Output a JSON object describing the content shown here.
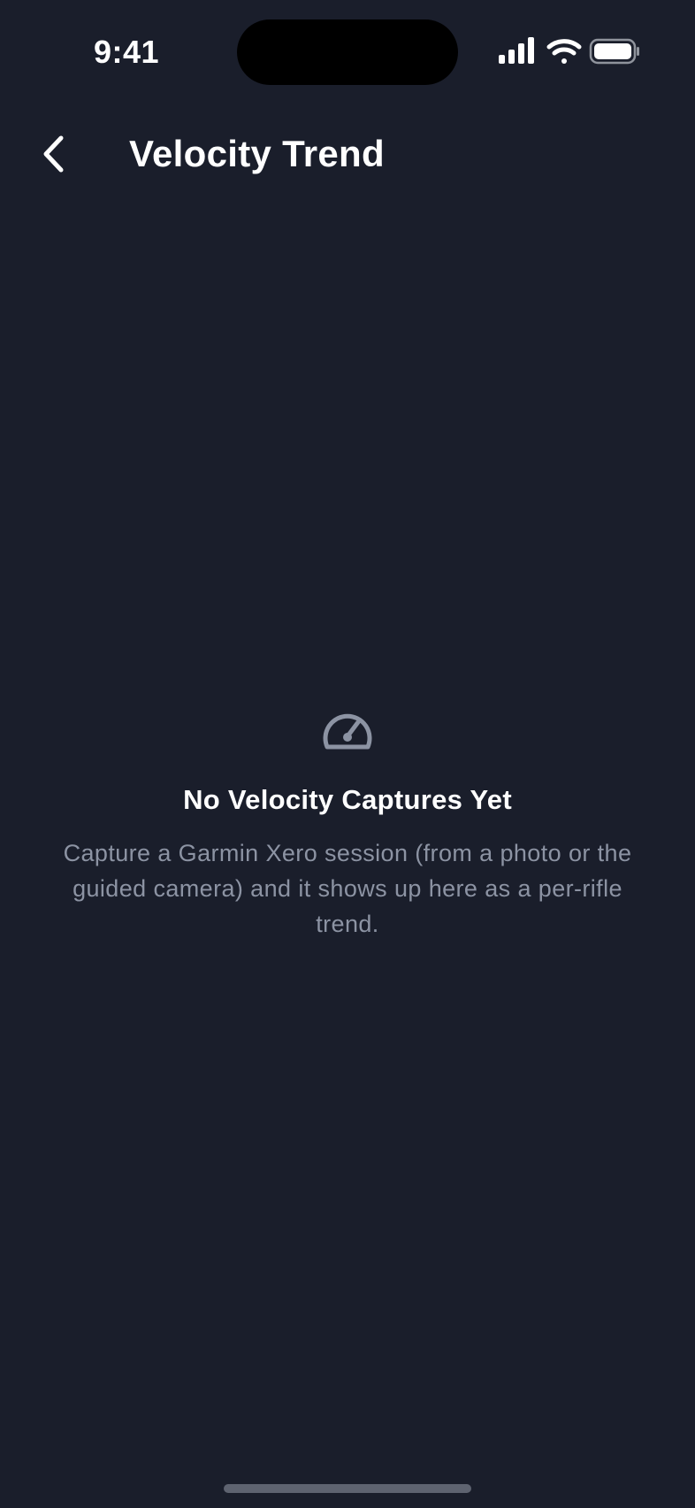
{
  "status_bar": {
    "time": "9:41"
  },
  "nav": {
    "back_icon": "chevron-left-icon",
    "title": "Velocity Trend"
  },
  "empty_state": {
    "icon": "speedometer-icon",
    "title": "No Velocity Captures Yet",
    "message": "Capture a Garmin Xero session (from a photo or the guided camera) and it shows up here as a per-rifle trend."
  },
  "colors": {
    "background": "#1a1e2b",
    "title_text": "#ffffff",
    "secondary_text": "#8c93a3",
    "icon": "#8c93a3"
  }
}
